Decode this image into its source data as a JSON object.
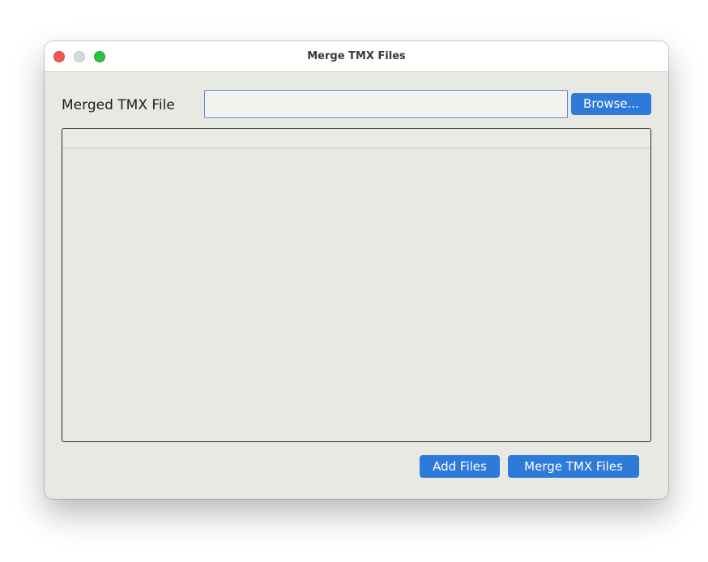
{
  "window": {
    "title": "Merge TMX Files"
  },
  "form": {
    "merged_file_label": "Merged TMX File",
    "merged_file_value": "",
    "browse_label": "Browse..."
  },
  "file_table": {
    "columns": [],
    "rows": []
  },
  "actions": {
    "add_files_label": "Add Files",
    "merge_label": "Merge TMX Files"
  },
  "colors": {
    "accent": "#2e7ad8",
    "window_bg": "#e9e9e4",
    "traffic_close": "#ee5a52",
    "traffic_minimize": "#d9d9d9",
    "traffic_zoom": "#2fc140"
  }
}
